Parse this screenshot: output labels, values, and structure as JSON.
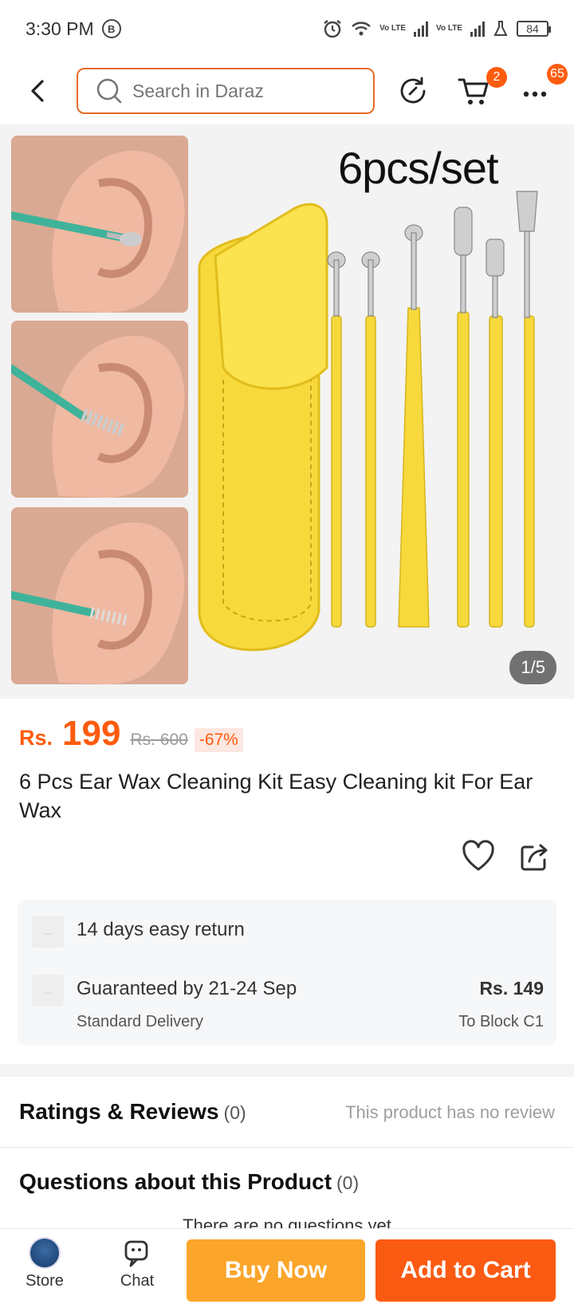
{
  "status_bar": {
    "time": "3:30 PM",
    "b_icon": "B",
    "battery": "84",
    "volte1": "Vo LTE",
    "volte2": "Vo LTE"
  },
  "header": {
    "search_placeholder": "Search in Daraz",
    "cart_badge": "2",
    "more_badge": "65"
  },
  "gallery": {
    "set_label": "6pcs/set",
    "counter": "1/5"
  },
  "price": {
    "currency": "Rs.",
    "current": "199",
    "original": "Rs. 600",
    "discount": "-67%"
  },
  "product": {
    "title": "6 Pcs Ear Wax Cleaning Kit Easy Cleaning kit For Ear Wax"
  },
  "delivery": {
    "return_text": "14 days easy return",
    "guarantee_text": "Guaranteed by 21-24 Sep",
    "method": "Standard Delivery",
    "fee": "Rs. 149",
    "destination": "To Block C1",
    "icon_placeholder": "..."
  },
  "ratings": {
    "title": "Ratings & Reviews",
    "count": "(0)",
    "note": "This product has no review"
  },
  "questions": {
    "title": "Questions about this Product",
    "count": "(0)",
    "empty_text": "There are no questions yet"
  },
  "bottom_bar": {
    "store_label": "Store",
    "chat_label": "Chat",
    "buy_now": "Buy Now",
    "add_to_cart": "Add to Cart"
  },
  "colors": {
    "accent": "#fe5c0f",
    "buy_now": "#fba52a",
    "add_to_cart": "#fb5a12",
    "search_border": "#e86b24",
    "pouch": "#f7d93b"
  }
}
